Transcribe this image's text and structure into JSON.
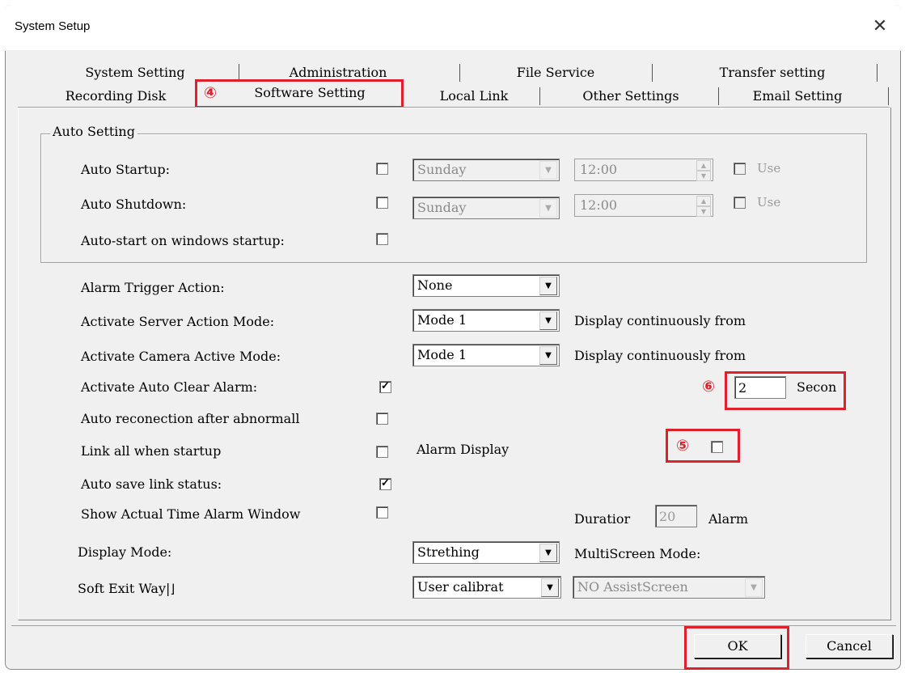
{
  "window": {
    "title": "System Setup",
    "close_glyph": "✕"
  },
  "tabs": {
    "row1": [
      "System Setting",
      "Administration",
      "File Service",
      "Transfer setting"
    ],
    "row2": [
      "Recording Disk",
      "Software Setting",
      "Local Link",
      "Other Settings",
      "Email Setting"
    ],
    "active": "Software Setting"
  },
  "auto_setting": {
    "group_label": "Auto Setting",
    "auto_startup": {
      "label": "Auto Startup:",
      "checked": false,
      "day": "Sunday",
      "time": "12:00",
      "use_label": "Use"
    },
    "auto_shutdown": {
      "label": "Auto Shutdown:",
      "checked": false,
      "day": "Sunday",
      "time": "12:00",
      "use_label": "Use"
    },
    "auto_start_windows": {
      "label": "Auto-start on windows startup:",
      "checked": false
    }
  },
  "settings": {
    "alarm_trigger": {
      "label": "Alarm Trigger Action:",
      "value": "None"
    },
    "server_action_mode": {
      "label": "Activate Server Action Mode:",
      "value": "Mode 1",
      "note": "Display continuously from"
    },
    "camera_active_mode": {
      "label": "Activate Camera Active Mode:",
      "value": "Mode 1",
      "note": "Display continuously from"
    },
    "auto_clear_alarm": {
      "label": "Activate Auto Clear Alarm:",
      "checked": true,
      "seconds_value": "2",
      "seconds_label": "Secon"
    },
    "auto_reconnect": {
      "label": "Auto reconection after abnormall",
      "checked": false
    },
    "link_all_startup": {
      "label": "Link all when startup",
      "checked": false
    },
    "alarm_display": {
      "label": "Alarm Display",
      "checked": false
    },
    "auto_save_link": {
      "label": "Auto save link status:",
      "checked": true
    },
    "show_alarm_window": {
      "label": "Show Actual Time Alarm Window",
      "checked": false
    },
    "duration": {
      "label": "Duratior",
      "value": "20",
      "suffix": "Alarm"
    },
    "display_mode": {
      "label": "Display Mode:",
      "value": "Strething"
    },
    "multiscreen": {
      "label": "MultiScreen Mode:",
      "value": "NO AssistScreen"
    },
    "soft_exit": {
      "label": "Soft Exit Way",
      "trailing_glyph": "|",
      "value": "User calibrat"
    }
  },
  "annotations": {
    "m4": "④",
    "m5": "⑤",
    "m6": "⑥",
    "color": "#e0202a"
  },
  "buttons": {
    "ok": "OK",
    "cancel": "Cancel"
  },
  "check_glyph": "✓"
}
